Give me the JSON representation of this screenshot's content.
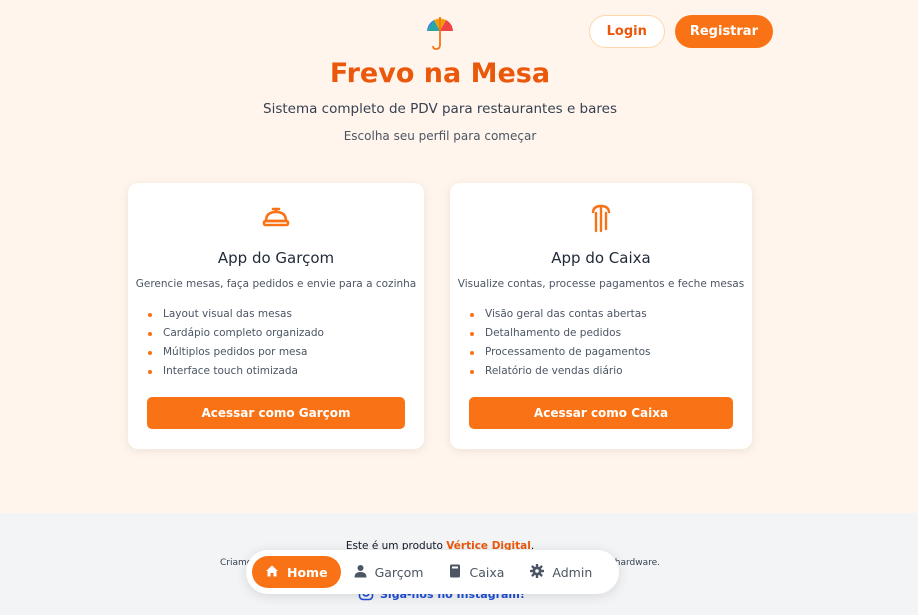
{
  "header": {
    "login_label": "Login",
    "register_label": "Registrar"
  },
  "hero": {
    "title": "Frevo na Mesa",
    "subtitle": "Sistema completo de PDV para restaurantes e bares",
    "choose": "Escolha seu perfil para começar"
  },
  "cards": [
    {
      "title": "App do Garçom",
      "description": "Gerencie mesas, faça pedidos e envie para a cozinha",
      "features": [
        "Layout visual das mesas",
        "Cardápio completo organizado",
        "Múltiplos pedidos por mesa",
        "Interface touch otimizada"
      ],
      "button": "Acessar como Garçom",
      "icon": "cloche-icon"
    },
    {
      "title": "App do Caixa",
      "description": "Visualize contas, processe pagamentos e feche mesas",
      "features": [
        "Visão geral das contas abertas",
        "Detalhamento de pedidos",
        "Processamento de pagamentos",
        "Relatório de vendas diário"
      ],
      "button": "Acessar como Caixa",
      "icon": "umbrella-icon"
    }
  ],
  "footer": {
    "product_prefix": "Este é um produto",
    "product_brand": "Vértice Digital",
    "product_suffix": ".",
    "created_left": "Criamo",
    "created_right": "hardware.",
    "instagram": "Siga-nos no Instagram!"
  },
  "nav": {
    "items": [
      {
        "label": "Home",
        "icon": "home-icon",
        "active": true
      },
      {
        "label": "Garçom",
        "icon": "user-icon"
      },
      {
        "label": "Caixa",
        "icon": "book-icon"
      },
      {
        "label": "Admin",
        "icon": "gear-icon"
      }
    ]
  },
  "colors": {
    "accent": "#f97316",
    "accent_dark": "#ea580c",
    "background": "#fff5ec"
  }
}
